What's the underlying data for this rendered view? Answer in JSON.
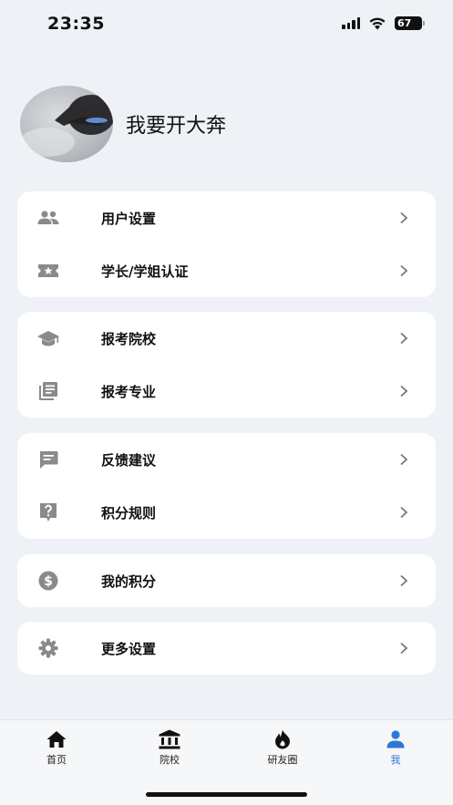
{
  "status_bar": {
    "time": "23:35",
    "battery": "67"
  },
  "profile": {
    "username": "我要开大奔"
  },
  "menu_groups": [
    {
      "items": [
        {
          "label": "用户设置",
          "icon": "people-icon"
        },
        {
          "label": "学长/学姐认证",
          "icon": "ticket-star-icon"
        }
      ]
    },
    {
      "items": [
        {
          "label": "报考院校",
          "icon": "graduation-cap-icon"
        },
        {
          "label": "报考专业",
          "icon": "library-books-icon"
        }
      ]
    },
    {
      "items": [
        {
          "label": "反馈建议",
          "icon": "chat-bubble-icon"
        },
        {
          "label": "积分规则",
          "icon": "help-box-icon"
        }
      ]
    },
    {
      "items": [
        {
          "label": "我的积分",
          "icon": "dollar-coin-icon"
        }
      ]
    },
    {
      "items": [
        {
          "label": "更多设置",
          "icon": "gear-icon"
        }
      ]
    }
  ],
  "tabbar": {
    "tabs": [
      {
        "label": "首页",
        "icon": "home-icon"
      },
      {
        "label": "院校",
        "icon": "bank-icon"
      },
      {
        "label": "研友圈",
        "icon": "flame-icon"
      },
      {
        "label": "我",
        "icon": "person-icon"
      }
    ],
    "active": "我",
    "active_color": "#2B78D6"
  },
  "colors": {
    "background": "#EEF1F6",
    "card": "#FFFFFF",
    "icon": "#8A8A8A",
    "accent": "#2B78D6"
  }
}
